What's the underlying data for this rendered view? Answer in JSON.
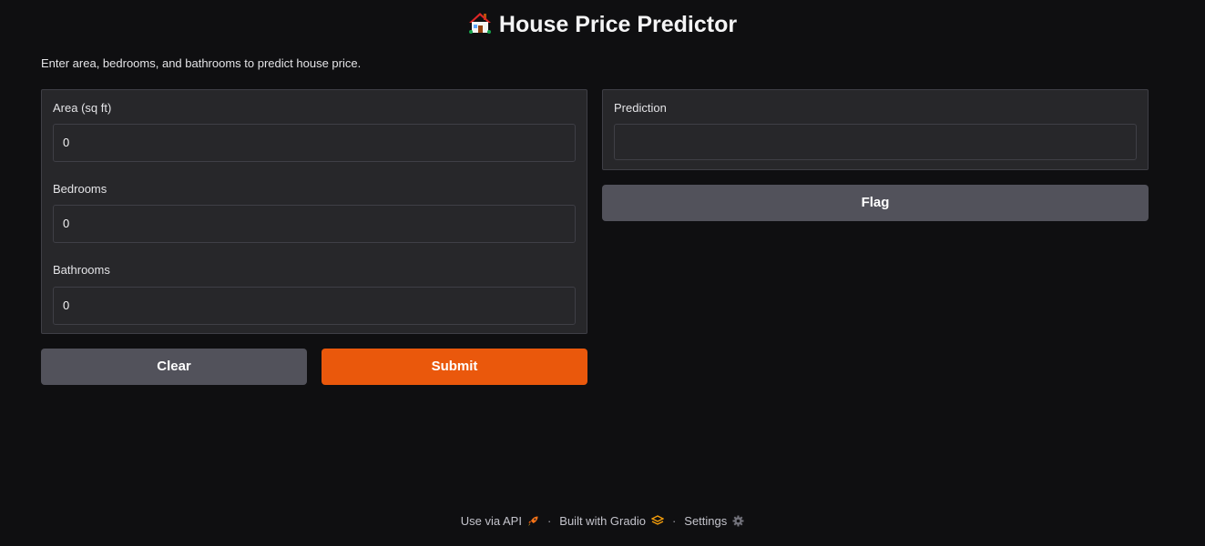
{
  "app": {
    "title": "House Price Predictor",
    "description": "Enter area, bedrooms, and bathrooms to predict house price."
  },
  "inputs": [
    {
      "label": "Area (sq ft)",
      "value": "0"
    },
    {
      "label": "Bedrooms",
      "value": "0"
    },
    {
      "label": "Bathrooms",
      "value": "0"
    }
  ],
  "output": {
    "label": "Prediction",
    "value": ""
  },
  "buttons": {
    "clear": "Clear",
    "submit": "Submit",
    "flag": "Flag"
  },
  "footer": {
    "api": "Use via API",
    "built": "Built with Gradio",
    "settings": "Settings",
    "separator": "·"
  },
  "icons": {
    "title": "house-emoji-icon",
    "api": "rocket-icon",
    "gradio": "gradio-logo-icon",
    "settings": "gear-icon"
  },
  "colors": {
    "background": "#0f0f11",
    "panel": "#27272a",
    "primary": "#ea580c",
    "secondary": "#52525b"
  }
}
